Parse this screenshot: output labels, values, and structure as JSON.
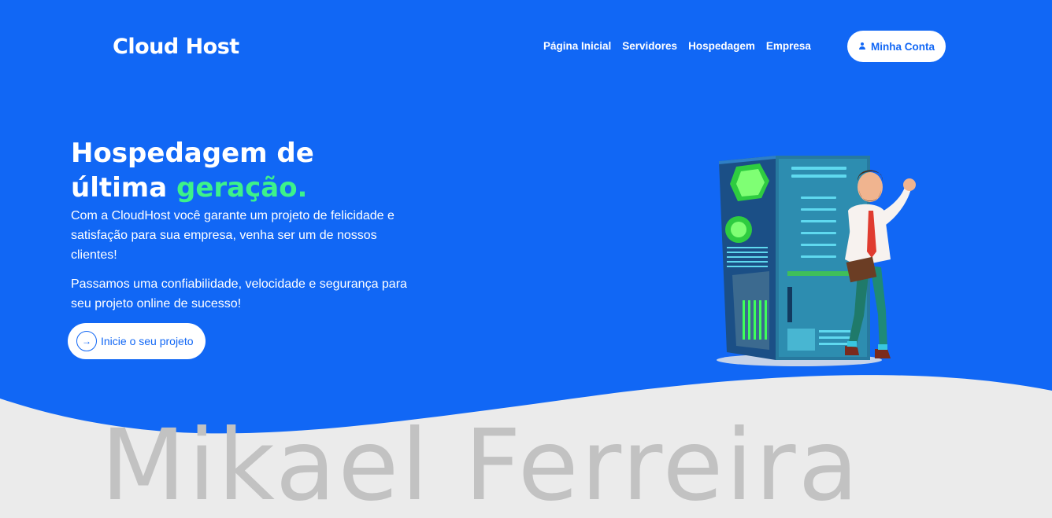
{
  "brand": {
    "logo": "Cloud Host"
  },
  "nav": {
    "items": [
      {
        "label": "Página Inicial"
      },
      {
        "label": "Servidores"
      },
      {
        "label": "Hospedagem"
      },
      {
        "label": "Empresa"
      }
    ],
    "account_label": "Minha Conta"
  },
  "hero": {
    "title_line1": "Hospedagem de",
    "title_line2_prefix": "última ",
    "title_accent": "geração.",
    "paragraph1": "Com a CloudHost você garante um projeto de felicidade e satisfação para sua empresa, venha ser um de nossos clientes!",
    "paragraph2": "Passamos uma confiabilidade, velocidade e segurança para seu projeto online de sucesso!",
    "cta_label": "Inicie o seu projeto"
  },
  "watermark": "Mikael Ferreira",
  "colors": {
    "primary": "#1167f5",
    "accent": "#3df28a",
    "background_bottom": "#ebebeb",
    "watermark": "#c2c2c2"
  },
  "icons": {
    "account": "user-icon",
    "cta": "arrow-right-icon"
  }
}
